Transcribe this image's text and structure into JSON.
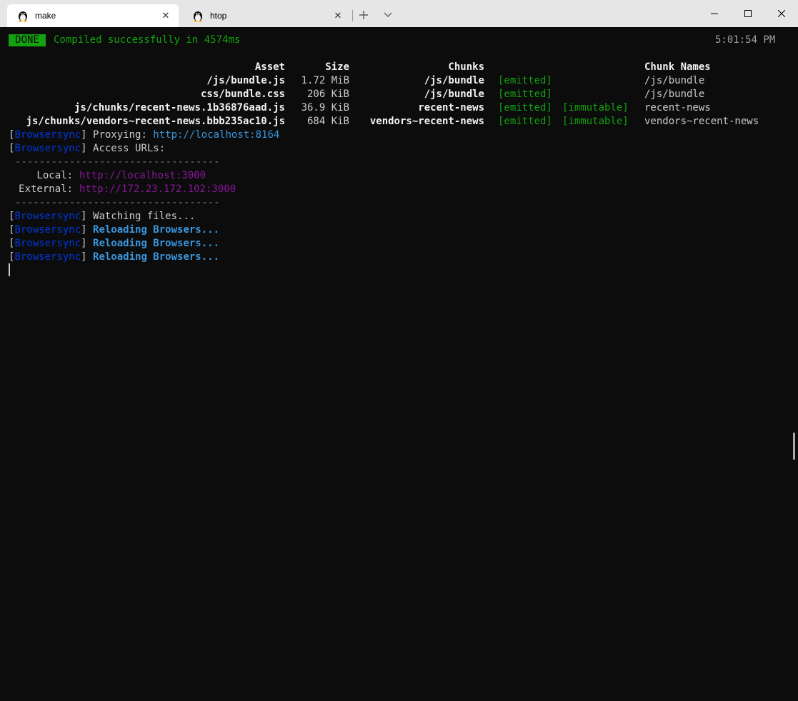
{
  "tabs": [
    {
      "label": "make",
      "icon": "linux-penguin-icon",
      "active": true
    },
    {
      "label": "htop",
      "icon": "linux-penguin-icon",
      "active": false
    }
  ],
  "window_controls": [
    "minimize",
    "maximize",
    "close"
  ],
  "status": {
    "badge": "DONE",
    "message": "Compiled successfully in 4574ms",
    "time": "5:01:54 PM"
  },
  "table": {
    "headers": {
      "asset": "Asset",
      "size": "Size",
      "chunks": "Chunks",
      "chunk_names": "Chunk Names"
    },
    "rows": [
      {
        "asset": "/js/bundle.js",
        "size": "1.72 MiB",
        "chunks": "/js/bundle",
        "emitted": "[emitted]",
        "immutable": "",
        "chunk_name": "/js/bundle"
      },
      {
        "asset": "css/bundle.css",
        "size": "206 KiB",
        "chunks": "/js/bundle",
        "emitted": "[emitted]",
        "immutable": "",
        "chunk_name": "/js/bundle"
      },
      {
        "asset": "js/chunks/recent-news.1b36876aad.js",
        "size": "36.9 KiB",
        "chunks": "recent-news",
        "emitted": "[emitted]",
        "immutable": "[immutable]",
        "chunk_name": "recent-news"
      },
      {
        "asset": "js/chunks/vendors~recent-news.bbb235ac10.js",
        "size": "684 KiB",
        "chunks": "vendors~recent-news",
        "emitted": "[emitted]",
        "immutable": "[immutable]",
        "chunk_name": "vendors~recent-news"
      }
    ]
  },
  "browsersync": {
    "tag": "Browsersync",
    "proxying_label": "Proxying:",
    "proxying_url": "http://localhost:8164",
    "access_urls": "Access URLs:",
    "separator": "----------------------------------",
    "local_label": "Local:",
    "local_url": "http://localhost:3000",
    "external_label": "External:",
    "external_url": "http://172.23.172.102:3000",
    "watching": "Watching files...",
    "reloading": "Reloading Browsers..."
  },
  "colors": {
    "green": "#13a10e",
    "blue": "#3a96dd",
    "dark_blue": "#0037da",
    "purple": "#881798",
    "background": "#0c0c0c"
  }
}
